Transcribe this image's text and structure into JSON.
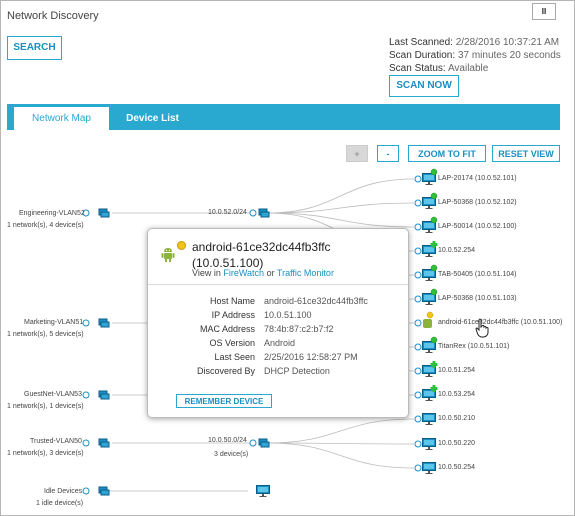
{
  "app": {
    "title": "Network Discovery",
    "pause_label": "II"
  },
  "search_label": "SEARCH",
  "scan": {
    "last_scanned_label": "Last Scanned:",
    "last_scanned": "2/28/2016 10:37:21 AM",
    "duration_label": "Scan Duration:",
    "duration": "37 minutes 20 seconds",
    "status_label": "Scan Status:",
    "status": "Available",
    "scan_now_label": "SCAN NOW"
  },
  "tabs": {
    "map": "Network Map",
    "list": "Device List"
  },
  "toolbar": {
    "zoom_in": "+",
    "zoom_out": "-",
    "zoom_fit": "ZOOM TO FIT",
    "reset_view": "RESET VIEW"
  },
  "vlans": [
    {
      "name": "Engineering-VLAN52",
      "summary": "1 network(s), 4 device(s)"
    },
    {
      "name": "Marketing-VLAN51",
      "summary": "1 network(s), 5 device(s)"
    },
    {
      "name": "GuestNet-VLAN53",
      "summary": "1 network(s), 1 device(s)"
    },
    {
      "name": "Trusted-VLAN50",
      "summary": "1 network(s), 3 device(s)"
    },
    {
      "name": "Idle Devices",
      "summary": "1 idle device(s)"
    }
  ],
  "subnets": [
    {
      "name": "10.0.52.0/24",
      "summary": ""
    },
    {
      "name": "10.0.50.0/24",
      "summary": "3 device(s)"
    }
  ],
  "devices": [
    {
      "label": "LAP-20174 (10.0.52.101)",
      "badge": "green"
    },
    {
      "label": "LAP-50368 (10.0.52.102)",
      "badge": "green"
    },
    {
      "label": "LAP-50014 (10.0.52.100)",
      "badge": "green"
    },
    {
      "label": "10.0.52.254",
      "badge": "plus"
    },
    {
      "label": "TAB-50405 (10.0.51.104)",
      "badge": "green"
    },
    {
      "label": "LAP-50368 (10.0.51.103)",
      "badge": "green"
    },
    {
      "label": "android-61ce32dc44fb3ffc (10.0.51.100)",
      "badge": "yellow"
    },
    {
      "label": "TitanRex (10.0.51.101)",
      "badge": "green"
    },
    {
      "label": "10.0.51.254",
      "badge": "plus"
    },
    {
      "label": "10.0.53.254",
      "badge": "plus"
    },
    {
      "label": "10.0.50.210",
      "badge": "none"
    },
    {
      "label": "10.0.50.220",
      "badge": "none"
    },
    {
      "label": "10.0.50.254",
      "badge": "none"
    }
  ],
  "popup": {
    "title_line1": "android-61ce32dc44fb3ffc",
    "title_line2": "(10.0.51.100)",
    "view_in": "View in",
    "firewatch": "FireWatch",
    "or": "or",
    "traffic_monitor": "Traffic Monitor",
    "fields": [
      {
        "key": "Host Name",
        "value": "android-61ce32dc44fb3ffc"
      },
      {
        "key": "IP Address",
        "value": "10.0.51.100"
      },
      {
        "key": "MAC Address",
        "value": "78:4b:87:c2:b7:f2"
      },
      {
        "key": "OS Version",
        "value": "Android"
      },
      {
        "key": "Last Seen",
        "value": "2/25/2016 12:58:27 PM"
      },
      {
        "key": "Discovered By",
        "value": "DHCP Detection"
      }
    ],
    "remember_label": "REMEMBER DEVICE"
  },
  "colors": {
    "accent": "#29a8d0",
    "badge_green": "#2fbf3a",
    "badge_yellow": "#f3c316"
  }
}
